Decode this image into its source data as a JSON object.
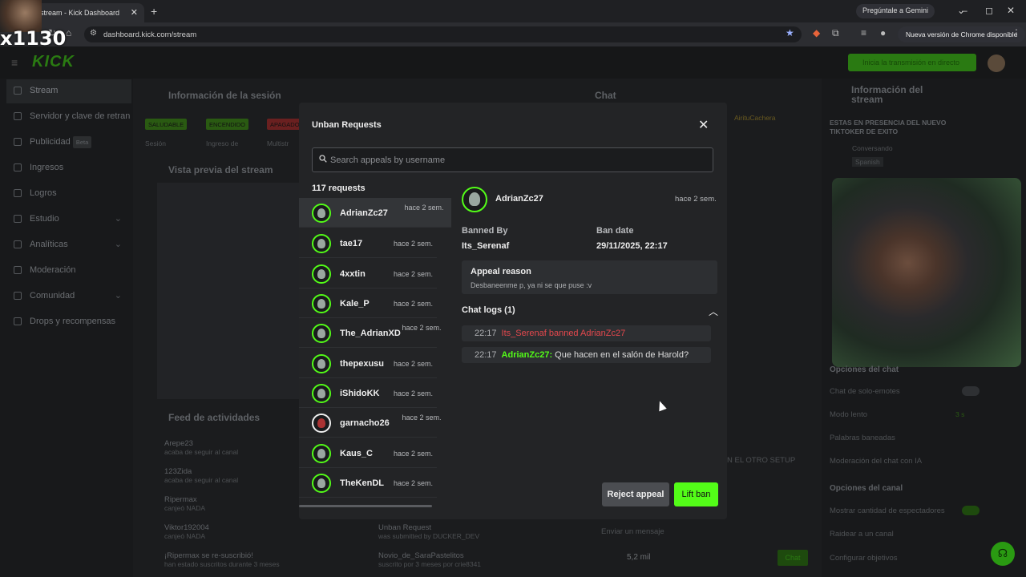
{
  "browser": {
    "tab_title": "stream - Kick Dashboard",
    "url": "dashboard.kick.com/stream",
    "gemini_button": "Pregúntale a Gemini",
    "update_button": "Nueva versión de Chrome disponible",
    "overlay_text": "x1130"
  },
  "header": {
    "logo": "KICK",
    "go_live": "Inicia la transmisión en directo"
  },
  "sidebar": {
    "items": [
      {
        "label": "Stream"
      },
      {
        "label": "Servidor y clave de retran"
      },
      {
        "label": "Publicidad",
        "badge": "Beta"
      },
      {
        "label": "Ingresos"
      },
      {
        "label": "Logros"
      },
      {
        "label": "Estudio"
      },
      {
        "label": "Analíticas"
      },
      {
        "label": "Moderación"
      },
      {
        "label": "Comunidad"
      },
      {
        "label": "Drops y recompensas"
      }
    ]
  },
  "background": {
    "session_title": "Información de la sesión",
    "badges": [
      "SALUDABLE",
      "ENCENDIDO",
      "APAGADO"
    ],
    "session_labels": [
      "Sesión",
      "Ingreso de",
      "Multistr"
    ],
    "preview_title": "Vista previa del stream",
    "chat_title": "Chat",
    "chat_user": "AirituCachera",
    "activity_title": "Feed de actividades",
    "activity": [
      {
        "name": "Arepe23",
        "sub": "acaba de seguir al canal"
      },
      {
        "name": "123Zida",
        "sub": "acaba de seguir al canal"
      },
      {
        "name": "Ripermax",
        "sub": "canjeó NADA"
      },
      {
        "name": "Viktor192004",
        "sub": "canjeó NADA"
      },
      {
        "name": "¡Ripermax se re-suscribió!",
        "sub": "han estado suscritos durante 3 meses"
      }
    ],
    "activity2": [
      {
        "name": "Unban Request",
        "sub": "was submitted by DUCKER_DEV"
      },
      {
        "name": "Novio_de_SaraPastelitos",
        "sub": "suscrito por 3 meses por crie8341"
      }
    ],
    "chat_snippet": "N EL OTRO SETUP",
    "chat_placeholder": "Enviar un mensaje",
    "viewers": "5,2 mil",
    "chat_button": "Chat"
  },
  "right_panel": {
    "title": "Información del stream",
    "stream_title": "ESTAS EN PRESENCIA DEL NUEVO TIKTOKER DE EXITO",
    "category": "Conversando",
    "language": "Spanish",
    "chat_options_title": "Opciones del chat",
    "chat_options": [
      {
        "label": "Chat de solo-emotes",
        "value": ""
      },
      {
        "label": "Modo lento",
        "value": "3 s"
      },
      {
        "label": "Palabras baneadas",
        "value": ""
      },
      {
        "label": "Moderación del chat con IA",
        "value": ""
      }
    ],
    "channel_options_title": "Opciones del canal",
    "channel_options": [
      {
        "label": "Mostrar cantidad de espectadores"
      },
      {
        "label": "Raidear a un canal"
      },
      {
        "label": "Configurar objetivos"
      }
    ]
  },
  "modal": {
    "title": "Unban Requests",
    "search_placeholder": "Search appeals by username",
    "request_count": "117 requests",
    "requests": [
      {
        "username": "AdrianZc27",
        "ago": "hace 2 sem.",
        "selected": true
      },
      {
        "username": "tae17",
        "ago": "hace 2 sem."
      },
      {
        "username": "4xxtin",
        "ago": "hace 2 sem."
      },
      {
        "username": "Kale_P",
        "ago": "hace 2 sem."
      },
      {
        "username": "The_AdrianXD",
        "ago": "hace 2 sem."
      },
      {
        "username": "thepexusu",
        "ago": "hace 2 sem."
      },
      {
        "username": "iShidoKK",
        "ago": "hace 2 sem."
      },
      {
        "username": "garnacho26",
        "ago": "hace 2 sem."
      },
      {
        "username": "Kaus_C",
        "ago": "hace 2 sem."
      },
      {
        "username": "TheKenDL",
        "ago": "hace 2 sem."
      }
    ],
    "detail": {
      "username": "AdrianZc27",
      "ago": "hace 2 sem.",
      "banned_by_label": "Banned By",
      "banned_by": "Its_Serenaf",
      "ban_date_label": "Ban date",
      "ban_date": "29/11/2025, 22:17",
      "appeal_label": "Appeal reason",
      "appeal_text": "Desbaneenme p, ya ni se que puse :v",
      "chat_logs_label": "Chat logs (1)",
      "logs": [
        {
          "time": "22:17",
          "text": "Its_Serenaf banned AdrianZc27"
        },
        {
          "time": "22:17",
          "user": "AdrianZc27:",
          "text": " Que hacen en el salón de Harold?"
        }
      ],
      "reject_button": "Reject appeal",
      "lift_button": "Lift ban"
    }
  },
  "colors": {
    "accent": "#53fc18",
    "danger": "#e5484d",
    "modal_bg": "#232426"
  }
}
